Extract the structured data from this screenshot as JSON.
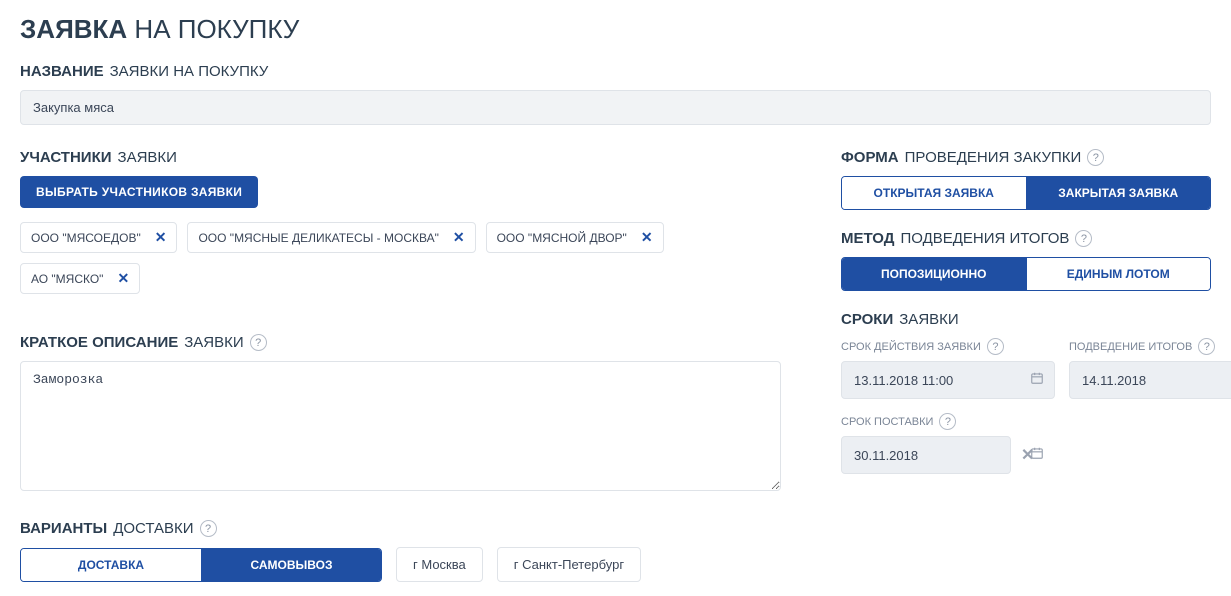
{
  "page_title_bold": "ЗАЯВКА",
  "page_title_rest": "НА ПОКУПКУ",
  "name_section": {
    "label_bold": "НАЗВАНИЕ",
    "label_rest": "ЗАЯВКИ НА ПОКУПКУ",
    "value": "Закупка мяса"
  },
  "participants": {
    "label_bold": "УЧАСТНИКИ",
    "label_rest": "ЗАЯВКИ",
    "button": "ВЫБРАТЬ УЧАСТНИКОВ ЗАЯВКИ",
    "items": [
      "ООО \"МЯСОЕДОВ\"",
      "ООО \"МЯСНЫЕ ДЕЛИКАТЕСЫ - МОСКВА\"",
      "ООО \"МЯСНОЙ ДВОР\"",
      "АО \"МЯСКО\""
    ]
  },
  "description": {
    "label_bold": "КРАТКОЕ ОПИСАНИЕ",
    "label_rest": "ЗАЯВКИ",
    "value": "Заморозка"
  },
  "delivery": {
    "label_bold": "ВАРИАНТЫ",
    "label_rest": "ДОСТАВКИ",
    "option_delivery": "ДОСТАВКА",
    "option_pickup": "САМОВЫВОЗ",
    "cities": [
      "г Москва",
      "г Санкт-Петербург"
    ]
  },
  "form": {
    "label_bold": "ФОРМА",
    "label_rest": "ПРОВЕДЕНИЯ ЗАКУПКИ",
    "option_open": "ОТКРЫТАЯ ЗАЯВКА",
    "option_closed": "ЗАКРЫТАЯ ЗАЯВКА"
  },
  "method": {
    "label_bold": "МЕТОД",
    "label_rest": "ПОДВЕДЕНИЯ ИТОГОВ",
    "option_positional": "ПОПОЗИЦИОННО",
    "option_lot": "ЕДИНЫМ ЛОТОМ"
  },
  "deadlines": {
    "label_bold": "СРОКИ",
    "label_rest": "ЗАЯВКИ",
    "validity_label": "СРОК ДЕЙСТВИЯ ЗАЯВКИ",
    "validity_value": "13.11.2018 11:00",
    "results_label": "ПОДВЕДЕНИЕ ИТОГОВ",
    "results_value": "14.11.2018",
    "supply_label": "СРОК ПОСТАВКИ",
    "supply_value": "30.11.2018"
  }
}
